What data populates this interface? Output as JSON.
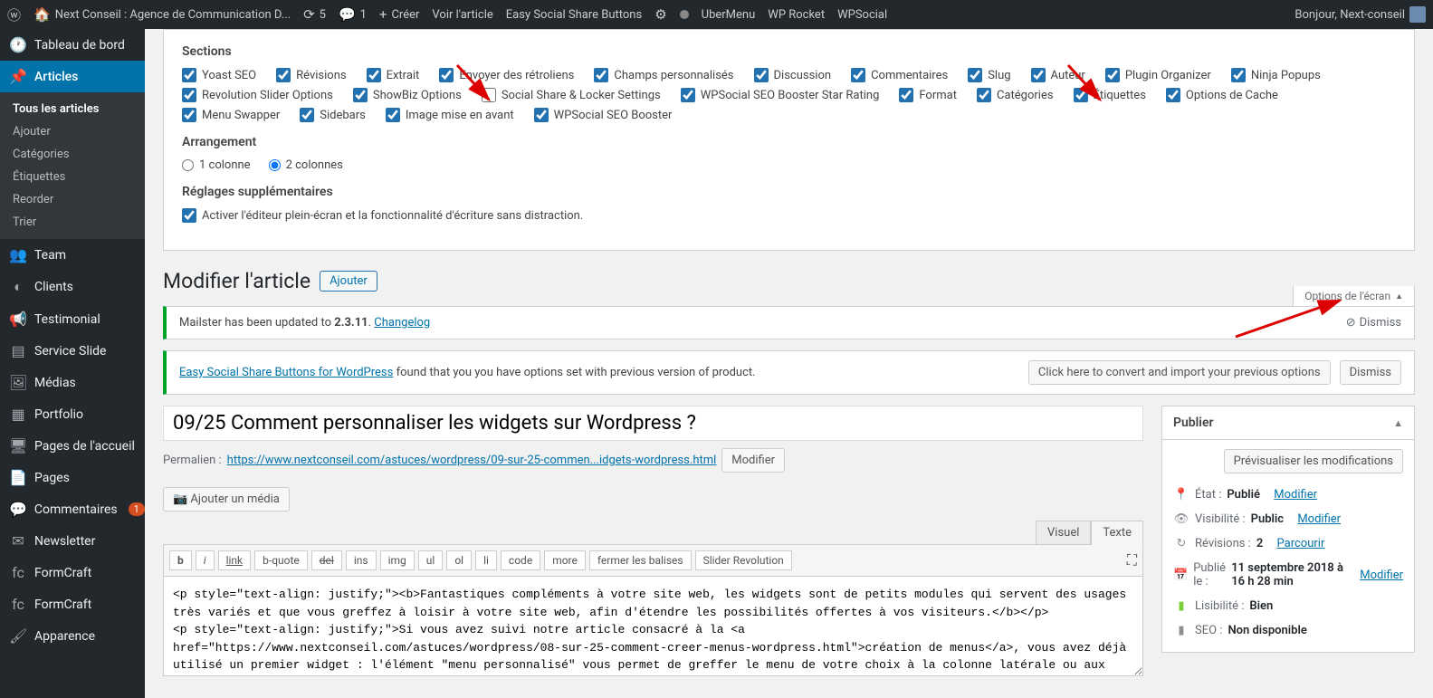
{
  "adminbar": {
    "site": "Next Conseil : Agence de Communication D...",
    "updates": "5",
    "comments": "1",
    "new": "Créer",
    "view": "Voir l'article",
    "essb": "Easy Social Share Buttons",
    "uber": "UberMenu",
    "rocket": "WP Rocket",
    "wpsocial": "WPSocial",
    "greeting": "Bonjour, Next-conseil"
  },
  "menu": {
    "dashboard": "Tableau de bord",
    "articles": "Articles",
    "sub": {
      "all": "Tous les articles",
      "add": "Ajouter",
      "cats": "Catégories",
      "tags": "Étiquettes",
      "reorder": "Reorder",
      "sort": "Trier"
    },
    "team": "Team",
    "clients": "Clients",
    "testimonial": "Testimonial",
    "slide": "Service Slide",
    "media": "Médias",
    "portfolio": "Portfolio",
    "pageshome": "Pages de l'accueil",
    "pages": "Pages",
    "comments": "Commentaires",
    "comments_count": "1",
    "newsletter": "Newsletter",
    "fc1": "FormCraft",
    "fc2": "FormCraft",
    "appearance": "Apparence"
  },
  "screen": {
    "sections_title": "Sections",
    "cbs": [
      {
        "l": "Yoast SEO",
        "c": true
      },
      {
        "l": "Révisions",
        "c": true
      },
      {
        "l": "Extrait",
        "c": true
      },
      {
        "l": "Envoyer des rétroliens",
        "c": true
      },
      {
        "l": "Champs personnalisés",
        "c": true
      },
      {
        "l": "Discussion",
        "c": true
      },
      {
        "l": "Commentaires",
        "c": true
      },
      {
        "l": "Slug",
        "c": true
      },
      {
        "l": "Auteur",
        "c": true
      },
      {
        "l": "Plugin Organizer",
        "c": true
      },
      {
        "l": "Ninja Popups",
        "c": true
      },
      {
        "l": "Revolution Slider Options",
        "c": true
      },
      {
        "l": "ShowBiz Options",
        "c": true
      },
      {
        "l": "Social Share & Locker Settings",
        "c": false
      },
      {
        "l": "WPSocial SEO Booster Star Rating",
        "c": true
      },
      {
        "l": "Format",
        "c": true
      },
      {
        "l": "Catégories",
        "c": true
      },
      {
        "l": "Étiquettes",
        "c": true
      },
      {
        "l": "Options de Cache",
        "c": true
      },
      {
        "l": "Menu Swapper",
        "c": true
      },
      {
        "l": "Sidebars",
        "c": true
      },
      {
        "l": "Image mise en avant",
        "c": true
      },
      {
        "l": "WPSocial SEO Booster",
        "c": true
      }
    ],
    "arr_title": "Arrangement",
    "col1": "1 colonne",
    "col2": "2 colonnes",
    "extra_title": "Réglages supplémentaires",
    "fullscreen": "Activer l'éditeur plein-écran et la fonctionnalité d'écriture sans distraction.",
    "tab": "Options de l'écran"
  },
  "head": {
    "title": "Modifier l'article",
    "add": "Ajouter"
  },
  "notice1": {
    "pre": "Mailster has been updated to ",
    "ver": "2.3.11",
    "dot": ". ",
    "link": "Changelog",
    "dismiss": "Dismiss"
  },
  "notice2": {
    "link": "Easy Social Share Buttons for WordPress",
    "rest": " found that you you have options set with previous version of product.",
    "btn": "Click here to convert and import your previous options",
    "dismiss": "Dismiss"
  },
  "post": {
    "title": "09/25 Comment personnaliser les widgets sur Wordpress ?",
    "perm_label": "Permalien : ",
    "perm_url": "https://www.nextconseil.com/astuces/wordpress/09-sur-25-commen...idgets-wordpress.html",
    "perm_edit": "Modifier",
    "add_media": "Ajouter un média",
    "tab_visual": "Visuel",
    "tab_text": "Texte",
    "qb": [
      "b",
      "i",
      "link",
      "b-quote",
      "del",
      "ins",
      "img",
      "ul",
      "ol",
      "li",
      "code",
      "more",
      "fermer les balises",
      "Slider Revolution"
    ],
    "content": "<p style=\"text-align: justify;\"><b>Fantastiques compléments à votre site web, les widgets sont de petits modules qui servent des usages très variés et que vous greffez à loisir à votre site web, afin d'étendre les possibilités offertes à vos visiteurs.</b></p>\n<p style=\"text-align: justify;\">Si vous avez suivi notre article consacré à la <a href=\"https://www.nextconseil.com/astuces/wordpress/08-sur-25-comment-creer-menus-wordpress.html\">création de menus</a>, vous avez déjà utilisé un premier widget : l'élément \"menu personnalisé\" vous permet de greffer le menu de votre choix à la colonne latérale ou aux zones du pied-de-page, par exemple. Les widgets ne sont pas à proprement parler des extensions telles que le conçoit WordPress, mais ils leur sont intimement liés. Considérez les extensions comme de nouvelles fonctionnalités à part"
  },
  "publish": {
    "title": "Publier",
    "preview": "Prévisualiser les modifications",
    "state_l": "État : ",
    "state_v": "Publié",
    "edit": "Modifier",
    "vis_l": "Visibilité : ",
    "vis_v": "Public",
    "rev_l": "Révisions : ",
    "rev_v": "2",
    "browse": "Parcourir",
    "date_l": "Publié le : ",
    "date_v": "11 septembre 2018 à 16 h 28 min",
    "read_l": "Lisibilité : ",
    "read_v": "Bien",
    "seo_l": "SEO : ",
    "seo_v": "Non disponible"
  }
}
